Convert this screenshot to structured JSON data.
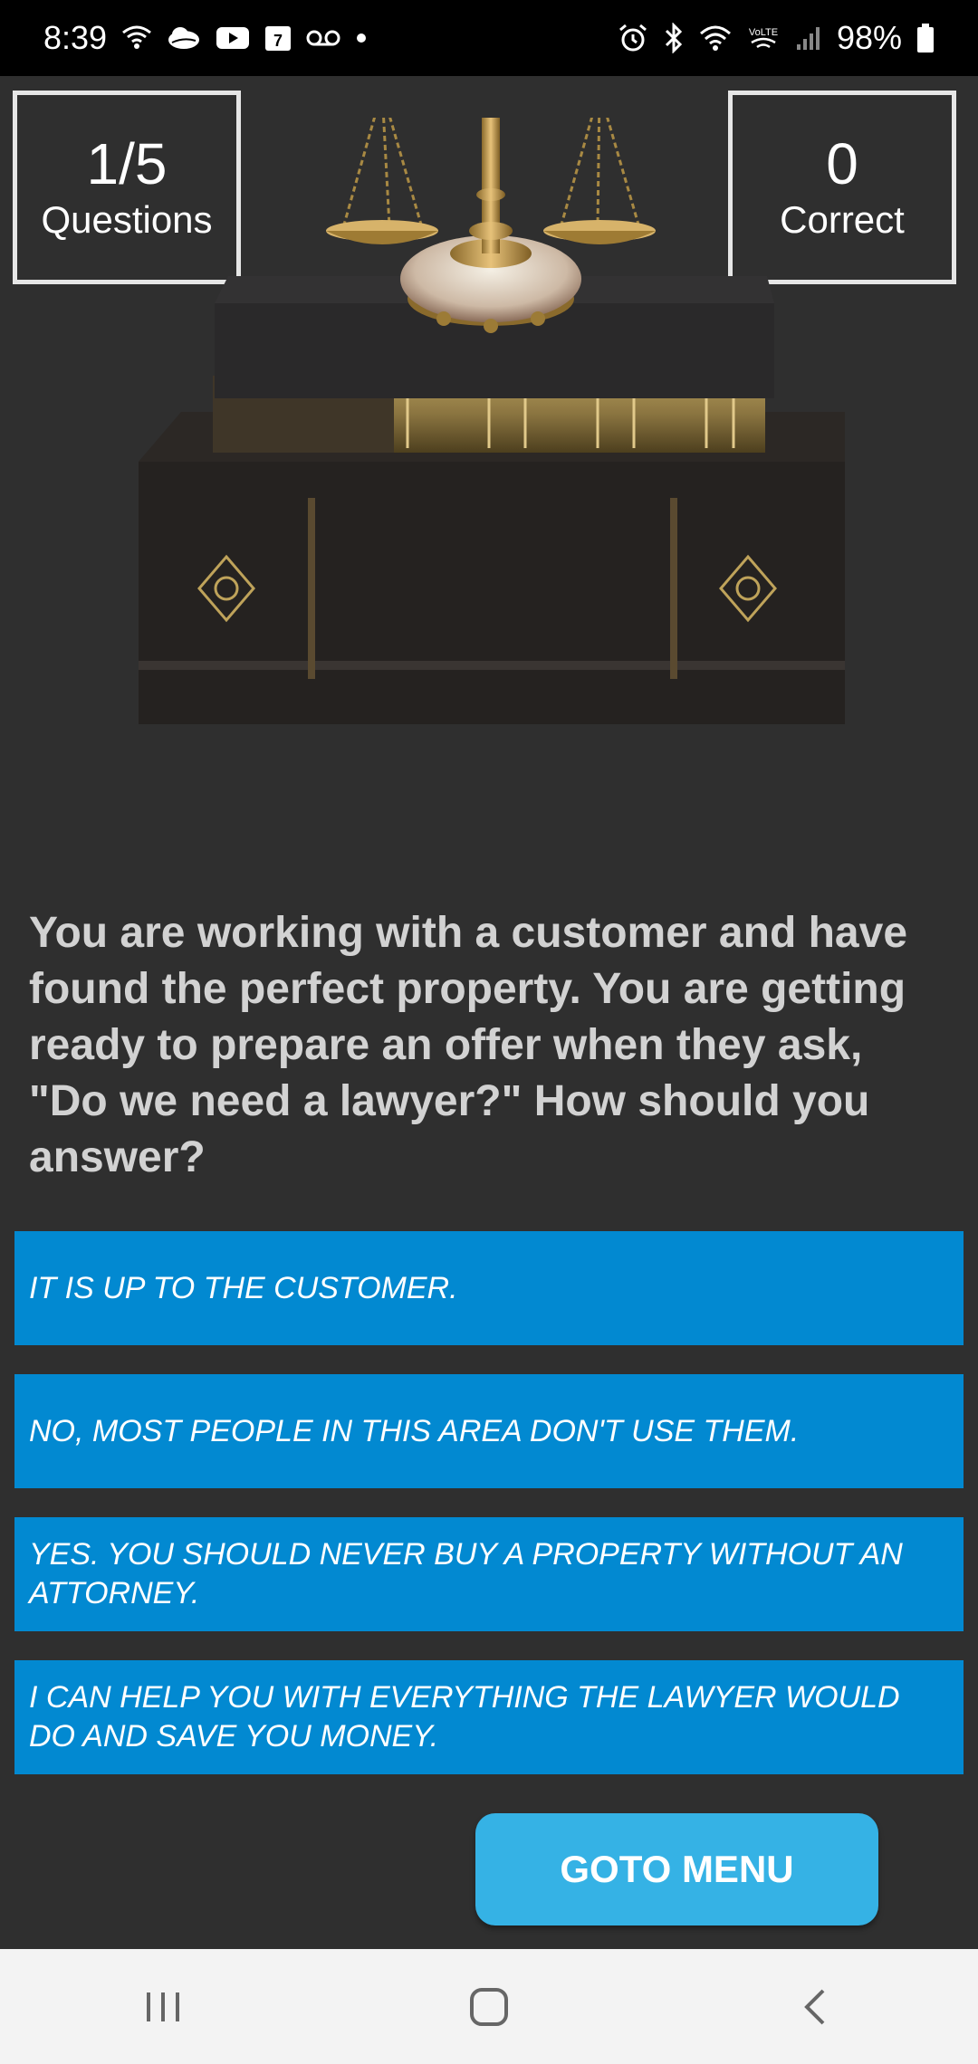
{
  "status_bar": {
    "time": "8:39",
    "left_icons": [
      "wifi-calling-icon",
      "cloud-icon",
      "youtube-icon",
      "calendar-icon",
      "voicemail-icon",
      "dot-icon"
    ],
    "calendar_day": "7",
    "right_icons": [
      "alarm-icon",
      "bluetooth-icon",
      "wifi-icon",
      "volte-icon",
      "signal-icon",
      "battery-icon"
    ],
    "volte_label": "VoLTE",
    "battery": "98%"
  },
  "scores": {
    "questions_value": "1/5",
    "questions_label": "Questions",
    "correct_value": "0",
    "correct_label": "Correct"
  },
  "illustration": {
    "icon": "scales-of-justice-on-books-image"
  },
  "question": "You are working with a customer and have found the perfect property. You are getting ready to prepare an offer when they ask, \"Do we need a lawyer?\" How should you answer?",
  "answers": [
    "IT IS UP TO THE CUSTOMER.",
    "NO, MOST PEOPLE IN THIS AREA DON'T USE THEM.",
    "YES. YOU SHOULD NEVER BUY A PROPERTY WITHOUT AN ATTORNEY.",
    "I CAN HELP YOU WITH EVERYTHING THE LAWYER WOULD DO AND SAVE YOU MONEY."
  ],
  "goto_menu_label": "GOTO MENU",
  "colors": {
    "background": "#2f2f2f",
    "answer_bg": "#0289d1",
    "goto_bg": "#35b2e5",
    "question_text": "#d2d2d2"
  },
  "nav_bar": {
    "icons": [
      "recent-apps-icon",
      "home-icon",
      "back-icon"
    ]
  }
}
